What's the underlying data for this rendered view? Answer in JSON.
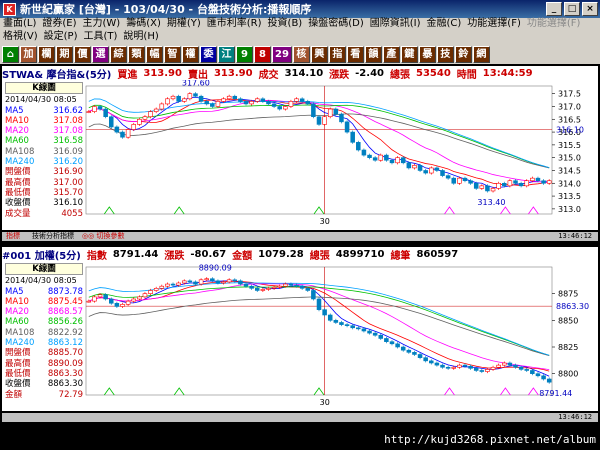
{
  "window": {
    "title": "新世紀贏家 [台灣] - 103/04/30 - 台盤技術分析:播報順序"
  },
  "menu": {
    "row1": [
      "畫面(L)",
      "證券(E)",
      "主力(W)",
      "籌碼(X)",
      "期權(Y)",
      "匯市利率(R)",
      "投資(B)",
      "操盤密碼(D)",
      "國際資訊(I)",
      "金融(C)",
      "功能選擇(F)",
      "功能選擇(F)"
    ],
    "row2": [
      "格視(V)",
      "設定(P)",
      "工具(T)",
      "說明(H)"
    ]
  },
  "toolbar": {
    "buttons": [
      "⌂",
      "加",
      "欄",
      "期",
      "價",
      "選",
      "綜",
      "類",
      "幅",
      "智",
      "權",
      "委",
      "江",
      "9",
      "8",
      "29",
      "核",
      "興",
      "指",
      "看",
      "韻",
      "產",
      "鍵",
      "暴",
      "技",
      "鈴",
      "網"
    ]
  },
  "panel1": {
    "header": {
      "symbol": "STWA& 摩台指&(5分)",
      "bid_label": "買進",
      "bid": "313.90",
      "ask_label": "賣出",
      "ask": "313.90",
      "trade_label": "成交",
      "trade": "314.10",
      "change_label": "漲跌",
      "change": "-2.40",
      "vol_label": "總張",
      "vol": "53540",
      "time_label": "時間",
      "time": "13:44:59"
    },
    "legend": {
      "title": "K線圖",
      "date": "2014/04/30 08:05",
      "items": [
        [
          "MA5",
          "316.62",
          "#0000ff"
        ],
        [
          "MA10",
          "317.08",
          "#ff0000"
        ],
        [
          "MA20",
          "317.08",
          "#ff00ff"
        ],
        [
          "MA60",
          "316.58",
          "#00c000"
        ],
        [
          "MA108",
          "316.09",
          "#606060"
        ],
        [
          "MA240",
          "316.20",
          "#00a0ff"
        ],
        [
          "開盤價",
          "316.90",
          "#c00000"
        ],
        [
          "最高價",
          "317.00",
          "#c00000"
        ],
        [
          "最低價",
          "315.70",
          "#c00000"
        ],
        [
          "收盤價",
          "316.10",
          "#000000"
        ],
        [
          "成交量",
          "4055",
          "#c00000"
        ]
      ]
    },
    "axis_ticks": [
      "317.5",
      "317.0",
      "316.5",
      "316.0",
      "315.5",
      "315.0",
      "314.5",
      "314.0",
      "313.5",
      "313.0"
    ],
    "price_label": "316.10",
    "hi_label": "317.60",
    "lo_label": "313.40",
    "x_label": "30"
  },
  "status1": {
    "s1": "指標",
    "s2": "技術分析指標",
    "s3": "◎◎ 切換參數",
    "time": "13:46:12"
  },
  "panel2": {
    "header": {
      "symbol": "#001 加權(5分)",
      "idx_label": "指數",
      "idx": "8791.44",
      "chg_label": "漲跌",
      "chg": "-80.67",
      "amt_label": "金額",
      "amt": "1079.28",
      "vol_label": "總張",
      "vol": "4899710",
      "cnt_label": "總筆",
      "cnt": "860597"
    },
    "legend": {
      "title": "K線圖",
      "date": "2014/04/30 08:05",
      "items": [
        [
          "MA5",
          "8873.78",
          "#0000ff"
        ],
        [
          "MA10",
          "8875.45",
          "#ff0000"
        ],
        [
          "MA20",
          "8868.57",
          "#ff00ff"
        ],
        [
          "MA60",
          "8856.26",
          "#00c000"
        ],
        [
          "MA108",
          "8822.92",
          "#606060"
        ],
        [
          "MA240",
          "8863.12",
          "#00a0ff"
        ],
        [
          "開盤價",
          "8885.70",
          "#c00000"
        ],
        [
          "最高價",
          "8890.09",
          "#c00000"
        ],
        [
          "最低價",
          "8863.30",
          "#c00000"
        ],
        [
          "收盤價",
          "8863.30",
          "#000000"
        ],
        [
          "金額",
          "72.79",
          "#c00000"
        ]
      ]
    },
    "axis_ticks": [
      "8875",
      "8850",
      "8825",
      "8800"
    ],
    "price_label": "8863.30",
    "hi_label": "8890.09",
    "lo_label": "8791.44",
    "x_label": "30"
  },
  "status2": {
    "time": "13:46:12"
  },
  "footer": {
    "url": "http://kujd3268.pixnet.net/album"
  },
  "chart_data": [
    {
      "type": "candlestick",
      "title": "STWA& 摩台指&(5分)",
      "x_label": "30",
      "ylim": [
        312.8,
        317.8
      ],
      "closes": [
        316.8,
        317.0,
        316.9,
        316.6,
        316.2,
        316.0,
        315.8,
        316.1,
        316.3,
        316.5,
        316.6,
        316.8,
        316.9,
        317.1,
        317.3,
        317.4,
        317.2,
        317.3,
        317.5,
        317.4,
        317.2,
        317.1,
        317.0,
        317.2,
        317.3,
        317.4,
        317.3,
        317.2,
        317.1,
        317.2,
        317.3,
        317.2,
        317.1,
        317.0,
        316.9,
        317.0,
        317.2,
        317.3,
        317.2,
        317.1,
        316.6,
        316.3,
        316.6,
        316.9,
        316.7,
        316.4,
        316.0,
        315.6,
        315.3,
        315.1,
        315.0,
        314.9,
        315.1,
        314.9,
        314.8,
        315.0,
        314.8,
        314.6,
        314.7,
        314.5,
        314.4,
        314.6,
        314.5,
        314.3,
        314.2,
        314.0,
        314.2,
        314.1,
        314.0,
        313.8,
        313.9,
        313.7,
        313.8,
        314.0,
        313.9,
        314.1,
        314.0,
        313.9,
        314.1,
        314.2,
        314.1,
        314.0,
        314.1
      ]
    },
    {
      "type": "candlestick",
      "title": "#001 加權(5分)",
      "x_label": "30",
      "ylim": [
        8780,
        8900
      ],
      "closes": [
        8868,
        8872,
        8874,
        8870,
        8866,
        8863,
        8865,
        8868,
        8870,
        8872,
        8875,
        8878,
        8880,
        8882,
        8884,
        8883,
        8885,
        8887,
        8886,
        8884,
        8888,
        8889,
        8887,
        8885,
        8886,
        8888,
        8887,
        8884,
        8882,
        8880,
        8878,
        8879,
        8880,
        8881,
        8882,
        8884,
        8883,
        8882,
        8880,
        8878,
        8870,
        8860,
        8855,
        8850,
        8848,
        8846,
        8845,
        8843,
        8842,
        8840,
        8838,
        8836,
        8833,
        8830,
        8828,
        8825,
        8822,
        8820,
        8818,
        8815,
        8812,
        8810,
        8808,
        8806,
        8805,
        8806,
        8808,
        8807,
        8805,
        8803,
        8802,
        8804,
        8806,
        8808,
        8810,
        8808,
        8806,
        8804,
        8803,
        8800,
        8798,
        8795,
        8792
      ]
    }
  ]
}
